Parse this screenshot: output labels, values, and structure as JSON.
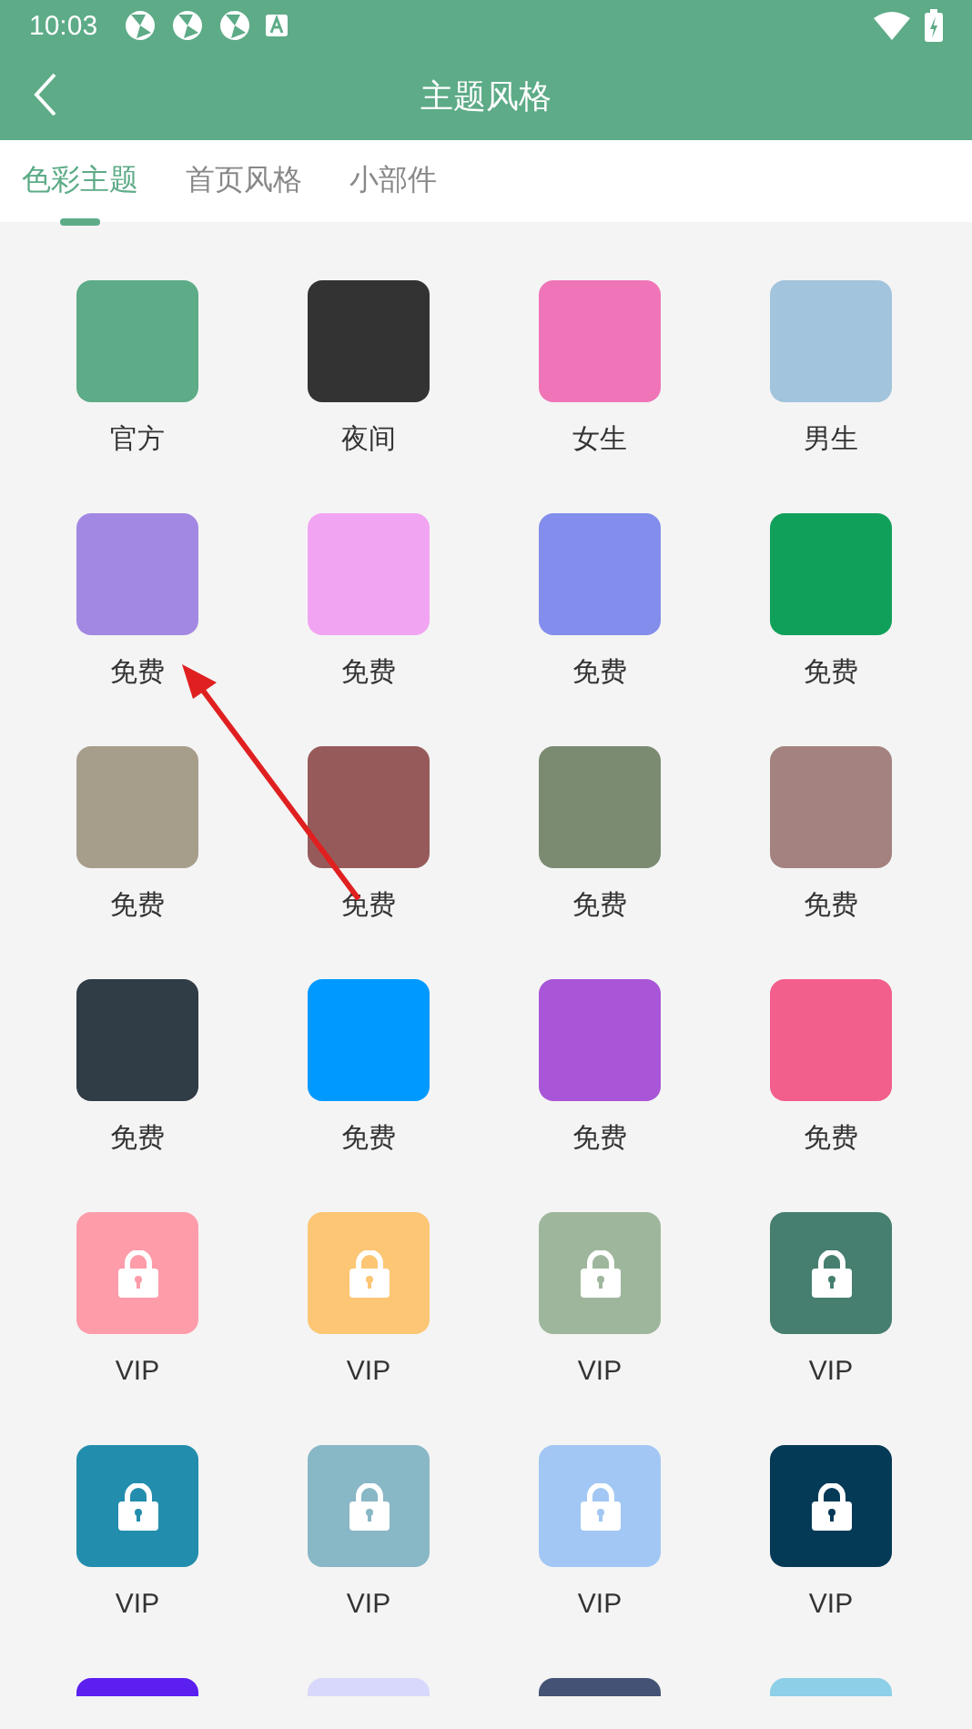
{
  "status_bar": {
    "time": "10:03"
  },
  "app_bar": {
    "title": "主题风格"
  },
  "tabs": [
    {
      "label": "色彩主题",
      "selected": true
    },
    {
      "label": "首页风格",
      "selected": false
    },
    {
      "label": "小部件",
      "selected": false
    }
  ],
  "themes": [
    {
      "label": "官方",
      "color": "#5dab87",
      "locked": false
    },
    {
      "label": "夜间",
      "color": "#333333",
      "locked": false
    },
    {
      "label": "女生",
      "color": "#f075b8",
      "locked": false
    },
    {
      "label": "男生",
      "color": "#a2c4dc",
      "locked": false
    },
    {
      "label": "免费",
      "color": "#a288e2",
      "locked": false
    },
    {
      "label": "免费",
      "color": "#f1a4f2",
      "locked": false
    },
    {
      "label": "免费",
      "color": "#838deb",
      "locked": false
    },
    {
      "label": "免费",
      "color": "#11a05a",
      "locked": false
    },
    {
      "label": "免费",
      "color": "#a79d8b",
      "locked": false
    },
    {
      "label": "免费",
      "color": "#975a5a",
      "locked": false
    },
    {
      "label": "免费",
      "color": "#7b8b72",
      "locked": false
    },
    {
      "label": "免费",
      "color": "#a4827f",
      "locked": false
    },
    {
      "label": "免费",
      "color": "#303c46",
      "locked": false
    },
    {
      "label": "免费",
      "color": "#0099ff",
      "locked": false
    },
    {
      "label": "免费",
      "color": "#a855d8",
      "locked": false
    },
    {
      "label": "免费",
      "color": "#f25f8c",
      "locked": false
    },
    {
      "label": "VIP",
      "color": "#fe9caa",
      "locked": true
    },
    {
      "label": "VIP",
      "color": "#fcc674",
      "locked": true
    },
    {
      "label": "VIP",
      "color": "#9eb79c",
      "locked": true
    },
    {
      "label": "VIP",
      "color": "#467f6f",
      "locked": true
    },
    {
      "label": "VIP",
      "color": "#238dad",
      "locked": true
    },
    {
      "label": "VIP",
      "color": "#88b7c6",
      "locked": true
    },
    {
      "label": "VIP",
      "color": "#a2c7f4",
      "locked": true
    },
    {
      "label": "VIP",
      "color": "#053a57",
      "locked": true
    },
    {
      "color": "#5b1ff0"
    },
    {
      "color": "#d8d8fc"
    },
    {
      "color": "#445275"
    },
    {
      "color": "#8ecfe8"
    }
  ]
}
